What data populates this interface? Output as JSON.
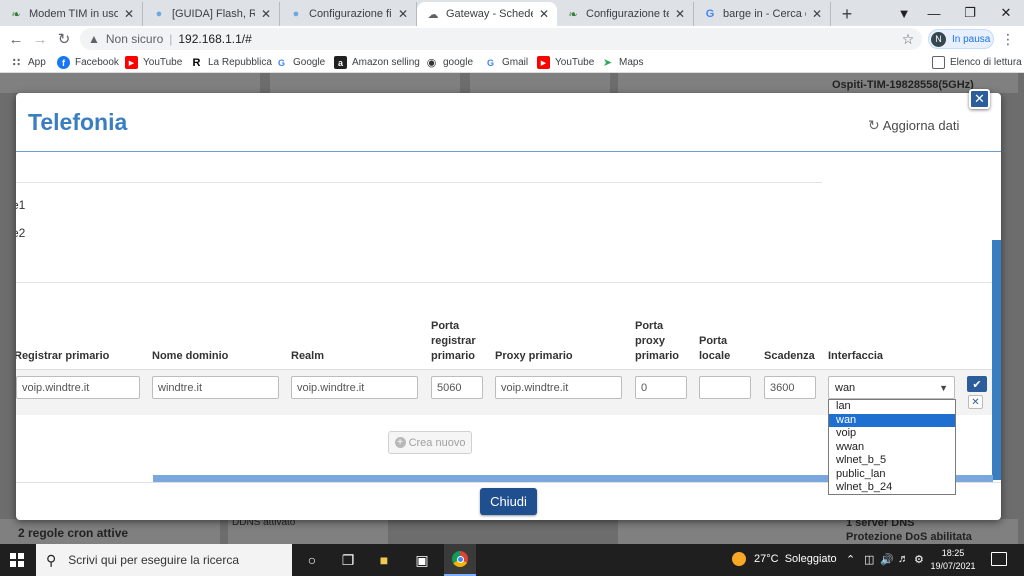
{
  "browser": {
    "tabs": [
      {
        "title": "Modem TIM in uso co",
        "icon": "leaf-icon"
      },
      {
        "title": "[GUIDA] Flash, Root e",
        "icon": "balloon-icon"
      },
      {
        "title": "Configurazione fibra In",
        "icon": "balloon-icon"
      },
      {
        "title": "Gateway - Schede",
        "icon": "cloud-icon"
      },
      {
        "title": "Configurazione telefo",
        "icon": "leaf-icon"
      },
      {
        "title": "barge in - Cerca con G",
        "icon": "google-icon"
      }
    ],
    "active_tab": 3,
    "address": {
      "security_label": "Non sicuro",
      "url": "192.168.1.1/#"
    },
    "profile": {
      "initial": "N",
      "status": "In pausa"
    },
    "bookmarks": [
      "App",
      "Facebook",
      "YouTube",
      "La Repubblica",
      "Google",
      "Amazon selling",
      "google",
      "Gmail",
      "YouTube",
      "Maps"
    ],
    "reading_list": "Elenco di lettura"
  },
  "background": {
    "wifi_label": "Ospiti-TIM-19828558(5GHz)",
    "cron_label": "2 regole cron attive",
    "ddns_label": "DDNS attivato",
    "dns_label": "1 server DNS",
    "dos_label": "Protezione DoS abilitata"
  },
  "modal": {
    "title": "Telefonia",
    "refresh_label": "Aggiorna dati",
    "rows": [
      "e1",
      "e2"
    ],
    "columns": [
      "Registrar primario",
      "Nome dominio",
      "Realm",
      "Porta\nregistrar\nprimario",
      "Proxy primario",
      "Porta\nproxy\nprimario",
      "Porta\nlocale",
      "Scadenza",
      "Interfaccia"
    ],
    "entry": {
      "registrar": "voip.windtre.it",
      "domain": "windtre.it",
      "realm": "voip.windtre.it",
      "registrar_port": "5060",
      "proxy": "voip.windtre.it",
      "proxy_port": "0",
      "local_port": "",
      "expiry": "3600",
      "interface": "wan"
    },
    "interface_options": [
      "lan",
      "wan",
      "voip",
      "wwan",
      "wlnet_b_5",
      "public_lan",
      "wlnet_b_24"
    ],
    "create_label": "Crea nuovo",
    "close_label": "Chiudi"
  },
  "taskbar": {
    "search_placeholder": "Scrivi qui per eseguire la ricerca",
    "weather": "27°C  Soleggiato",
    "time": "18:25",
    "date": "19/07/2021"
  }
}
